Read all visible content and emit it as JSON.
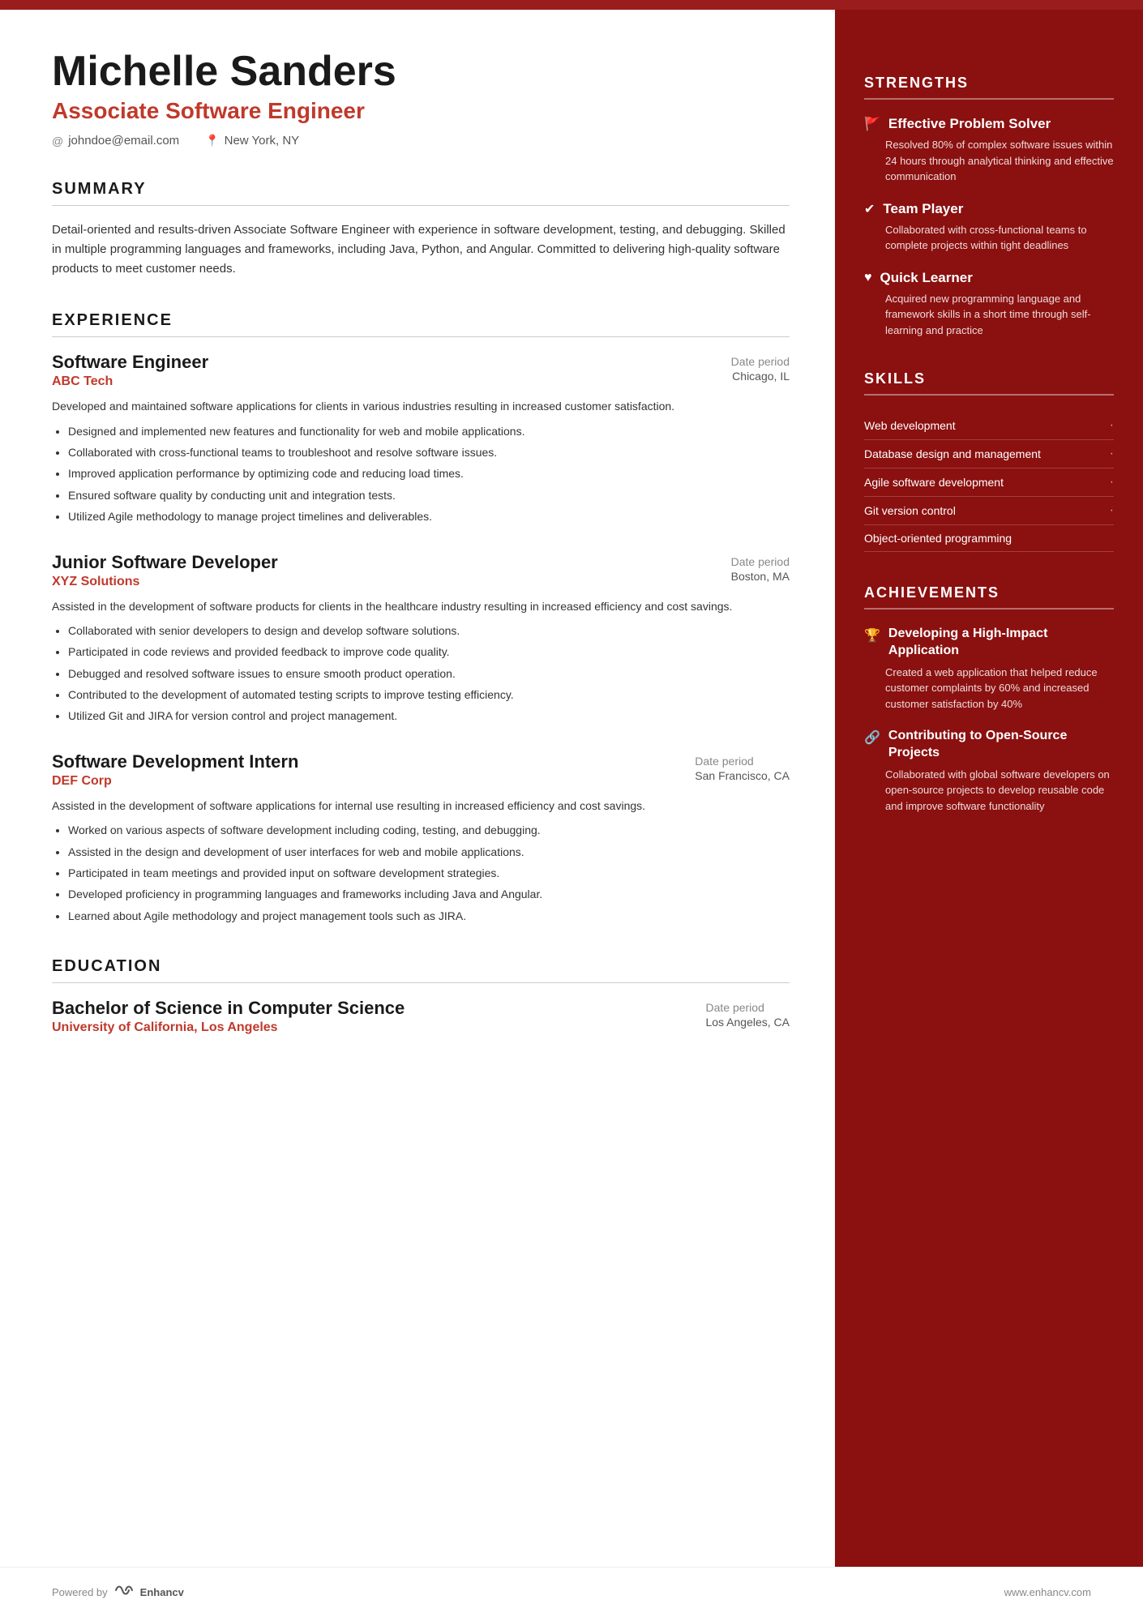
{
  "topBar": {},
  "header": {
    "name": "Michelle Sanders",
    "jobTitle": "Associate Software Engineer",
    "email": "johndoe@email.com",
    "location": "New York, NY"
  },
  "summary": {
    "sectionTitle": "SUMMARY",
    "text": "Detail-oriented and results-driven Associate Software Engineer with experience in software development, testing, and debugging. Skilled in multiple programming languages and frameworks, including Java, Python, and Angular. Committed to delivering high-quality software products to meet customer needs."
  },
  "experience": {
    "sectionTitle": "EXPERIENCE",
    "entries": [
      {
        "role": "Software Engineer",
        "company": "ABC Tech",
        "date": "Date period",
        "location": "Chicago, IL",
        "description": "Developed and maintained software applications for clients in various industries resulting in increased customer satisfaction.",
        "bullets": [
          "Designed and implemented new features and functionality for web and mobile applications.",
          "Collaborated with cross-functional teams to troubleshoot and resolve software issues.",
          "Improved application performance by optimizing code and reducing load times.",
          "Ensured software quality by conducting unit and integration tests.",
          "Utilized Agile methodology to manage project timelines and deliverables."
        ]
      },
      {
        "role": "Junior Software Developer",
        "company": "XYZ Solutions",
        "date": "Date period",
        "location": "Boston, MA",
        "description": "Assisted in the development of software products for clients in the healthcare industry resulting in increased efficiency and cost savings.",
        "bullets": [
          "Collaborated with senior developers to design and develop software solutions.",
          "Participated in code reviews and provided feedback to improve code quality.",
          "Debugged and resolved software issues to ensure smooth product operation.",
          "Contributed to the development of automated testing scripts to improve testing efficiency.",
          "Utilized Git and JIRA for version control and project management."
        ]
      },
      {
        "role": "Software Development Intern",
        "company": "DEF Corp",
        "date": "Date period",
        "location": "San Francisco, CA",
        "description": "Assisted in the development of software applications for internal use resulting in increased efficiency and cost savings.",
        "bullets": [
          "Worked on various aspects of software development including coding, testing, and debugging.",
          "Assisted in the design and development of user interfaces for web and mobile applications.",
          "Participated in team meetings and provided input on software development strategies.",
          "Developed proficiency in programming languages and frameworks including Java and Angular.",
          "Learned about Agile methodology and project management tools such as JIRA."
        ]
      }
    ]
  },
  "education": {
    "sectionTitle": "EDUCATION",
    "entries": [
      {
        "degree": "Bachelor of Science in Computer Science",
        "school": "University of California, Los Angeles",
        "date": "Date period",
        "location": "Los Angeles, CA"
      }
    ]
  },
  "footer": {
    "poweredBy": "Powered by",
    "brand": "Enhancv",
    "website": "www.enhancv.com"
  },
  "strengths": {
    "sectionTitle": "STRENGTHS",
    "items": [
      {
        "icon": "🚩",
        "title": "Effective Problem Solver",
        "description": "Resolved 80% of complex software issues within 24 hours through analytical thinking and effective communication"
      },
      {
        "icon": "✔",
        "title": "Team Player",
        "description": "Collaborated with cross-functional teams to complete projects within tight deadlines"
      },
      {
        "icon": "♥",
        "title": "Quick Learner",
        "description": "Acquired new programming language and framework skills in a short time through self-learning and practice"
      }
    ]
  },
  "skills": {
    "sectionTitle": "SKILLS",
    "items": [
      {
        "name": "Web development",
        "hasDot": true
      },
      {
        "name": "Database design and management",
        "hasDot": true
      },
      {
        "name": "Agile software development",
        "hasDot": true
      },
      {
        "name": "Git version control",
        "hasDot": true
      },
      {
        "name": "Object-oriented programming",
        "hasDot": false
      }
    ]
  },
  "achievements": {
    "sectionTitle": "ACHIEVEMENTS",
    "items": [
      {
        "icon": "🏆",
        "title": "Developing a High-Impact Application",
        "description": "Created a web application that helped reduce customer complaints by 60% and increased customer satisfaction by 40%"
      },
      {
        "icon": "🔗",
        "title": "Contributing to Open-Source Projects",
        "description": "Collaborated with global software developers on open-source projects to develop reusable code and improve software functionality"
      }
    ]
  }
}
